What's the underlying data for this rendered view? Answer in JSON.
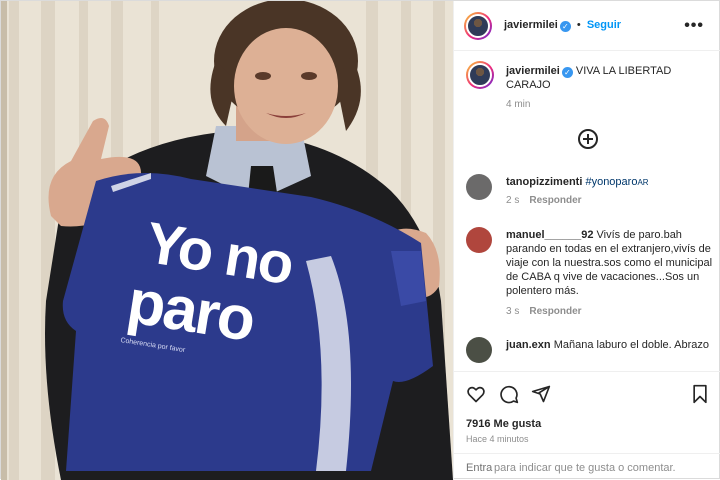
{
  "post": {
    "shirt_line1": "Yo no",
    "shirt_line2": "paro",
    "shirt_small": "Coherencia por favor"
  },
  "header": {
    "username": "javiermilei",
    "verified_icon": "verified-badge-icon",
    "separator": "•",
    "follow_label": "Seguir",
    "more_icon": "more-options-icon"
  },
  "caption": {
    "username": "javiermilei",
    "text": "VIVA LA LIBERTAD CARAJO",
    "time": "4 min"
  },
  "load_more_icon": "plus-circle-icon",
  "comments": [
    {
      "username": "tanopizzimenti",
      "text": "#yonoparo",
      "tag_suffix": "AR",
      "time": "2 s",
      "reply": "Responder",
      "avatar_color": "#6b6a6a"
    },
    {
      "username": "manuel______92",
      "text": "Vivís de paro.bah parando en todas en el extranjero,vivís de viaje con la nuestra.sos como el municipal de CABA q vive de vacaciones...Sos un polentero más.",
      "time": "3 s",
      "reply": "Responder",
      "avatar_color": "#b0463d"
    },
    {
      "username": "juan.exn",
      "text": "Mañana laburo el doble. Abrazo",
      "avatar_color": "#4b4f45"
    }
  ],
  "actions": {
    "like_icon": "heart-icon",
    "comment_icon": "comment-icon",
    "share_icon": "share-icon",
    "save_icon": "bookmark-icon"
  },
  "likes_text": "7916 Me gusta",
  "ago_text": "Hace 4 minutos",
  "add_comment": {
    "link": "Entra",
    "text": "para indicar que te gusta o comentar."
  },
  "colors": {
    "accent": "#0095f6",
    "shirt": "#2c3a8c",
    "verified": "#3897f0"
  }
}
